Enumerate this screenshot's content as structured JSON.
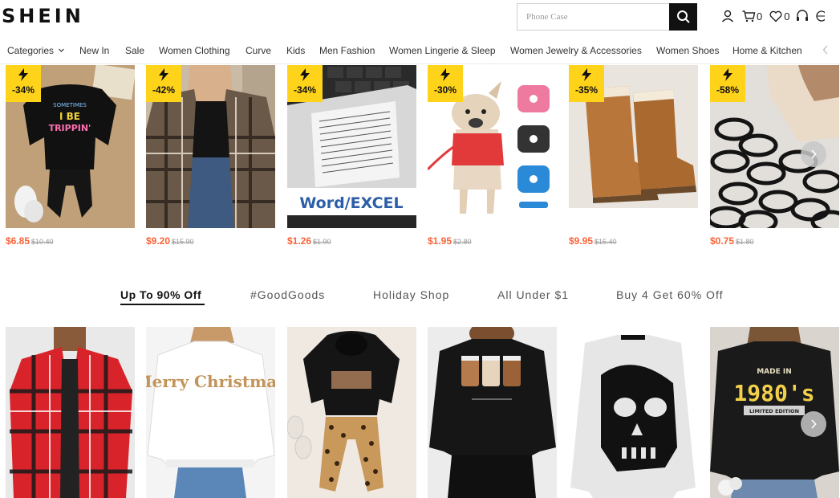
{
  "header": {
    "logo": "SHEIN",
    "search_placeholder": "Phone Case",
    "cart_count": "0",
    "wishlist_count": "0"
  },
  "nav": {
    "items": [
      "Categories",
      "New In",
      "Sale",
      "Women Clothing",
      "Curve",
      "Kids",
      "Men Fashion",
      "Women Lingerie & Sleep",
      "Women Jewelry & Accessories",
      "Women Shoes",
      "Home & Kitchen"
    ]
  },
  "flash_products": [
    {
      "discount": "-34%",
      "price": "$6.85",
      "original": "$10.40",
      "image": "kids sweatshirt set with 'Sometimes I Be Trippin' print"
    },
    {
      "discount": "-42%",
      "price": "$9.20",
      "original": "$15.90",
      "image": "plaid shirt jacket over black top"
    },
    {
      "discount": "-34%",
      "price": "$1.26",
      "original": "$1.90",
      "image": "keyboard shortcut sticker"
    },
    {
      "discount": "-30%",
      "price": "$1.95",
      "original": "$2.80",
      "image": "dog harness set"
    },
    {
      "discount": "-35%",
      "price": "$9.95",
      "original": "$15.40",
      "image": "brown snow boots"
    },
    {
      "discount": "-58%",
      "price": "$0.75",
      "original": "$1.80",
      "image": "black hair ties"
    }
  ],
  "flash_sticker_text": [
    "Word/EXCEL"
  ],
  "kids_print_text": [
    "SOMETIMES",
    "I BE",
    "TRIPPIN'"
  ],
  "sweater_text": "Merry Christmas",
  "shirt_1980_text": [
    "MADE IN",
    "1980's",
    "LIMITED EDITION"
  ],
  "tabs": {
    "items": [
      "Up To 90% Off",
      "#GoodGoods",
      "Holiday Shop",
      "All Under $1",
      "Buy 4 Get 60% Off"
    ],
    "active_index": 0
  },
  "colors": {
    "price": "#fa6338",
    "flash_badge": "#ffd31a",
    "search_button": "#111111"
  }
}
